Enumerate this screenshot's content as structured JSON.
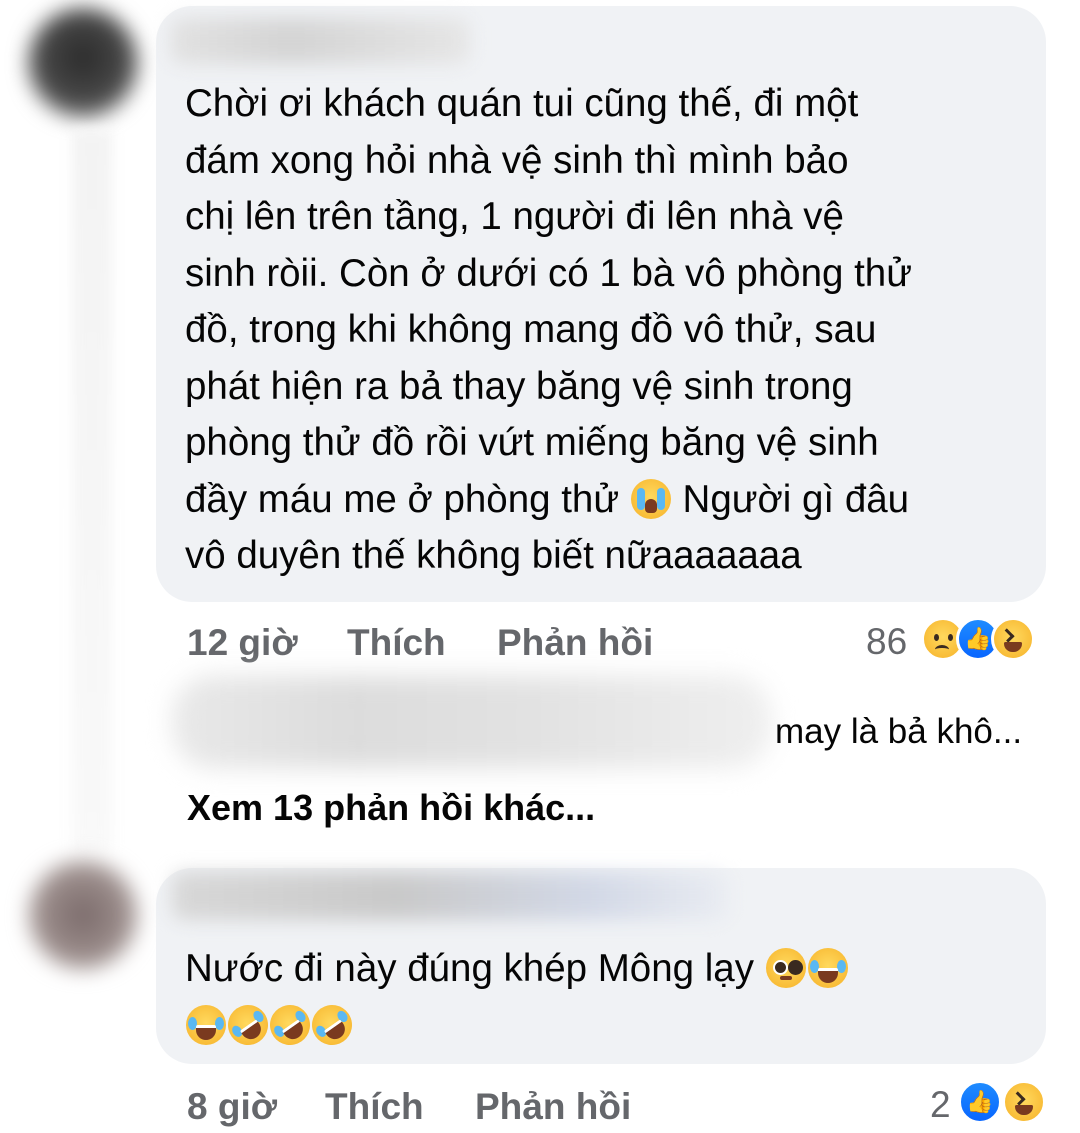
{
  "comments": [
    {
      "author": "",
      "text_lines": [
        "Chời ơi khách quán tui cũng thế, đi một",
        "đám xong hỏi nhà vệ sinh thì mình bảo",
        "chị lên trên tầng, 1 người đi lên nhà vệ",
        "sinh ròii. Còn ở dưới có 1 bà vô phòng thử",
        "đồ, trong khi không mang đồ vô thử, sau",
        "phát hiện ra bả thay băng vệ sinh trong",
        "phòng thử đồ rồi vứt miếng băng vệ sinh",
        "đầy máu me ở phòng thử",
        "Người gì đâu",
        "vô duyên thế không biết nữaaaaaaa"
      ],
      "inline_emoji": "loudly-crying-face",
      "time": "12 giờ",
      "like_label": "Thích",
      "reply_label": "Phản hồi",
      "reaction_count": "86",
      "reaction_icons": [
        "sad-reaction-icon",
        "like-reaction-icon",
        "haha-reaction-icon"
      ]
    },
    {
      "author": "",
      "text_lines": [
        "Nước đi này đúng khép Mông lạy"
      ],
      "emojis_line1": [
        "pleading-face",
        "face-with-tears-of-joy"
      ],
      "emojis_line2": [
        "face-with-tears-of-joy",
        "rolling-on-the-floor-laughing",
        "rolling-on-the-floor-laughing",
        "rolling-on-the-floor-laughing"
      ],
      "time": "8 giờ",
      "like_label": "Thích",
      "reply_label": "Phản hồi",
      "reaction_count": "2",
      "reaction_icons": [
        "like-reaction-icon",
        "haha-reaction-icon"
      ]
    }
  ],
  "reply_preview": {
    "text": "may là bả khô..."
  },
  "view_more_replies": "Xem 13 phản hồi khác...",
  "colors": {
    "bubble_bg": "#f0f2f5",
    "text_primary": "#050505",
    "text_secondary": "#65676b",
    "like_blue": "#0866ff"
  }
}
